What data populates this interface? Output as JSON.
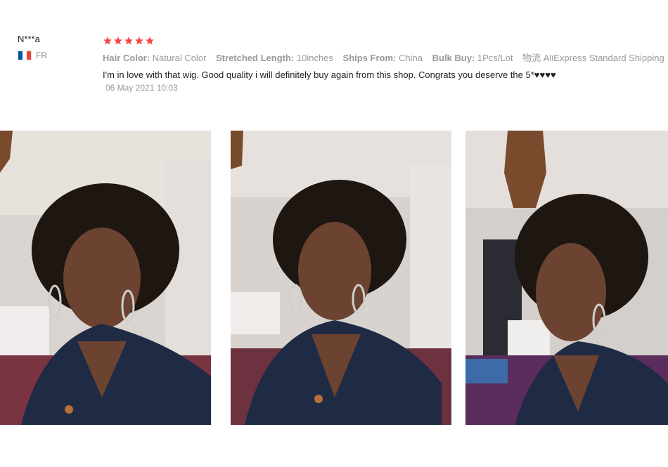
{
  "reviewer": {
    "name": "N***a",
    "country_code": "FR",
    "flag_colors": [
      "#0055a4",
      "#ffffff",
      "#ef4135"
    ]
  },
  "review": {
    "rating": 5,
    "star_color": "#f54646",
    "attributes": [
      {
        "key": "Hair Color:",
        "value": "Natural Color"
      },
      {
        "key": "Stretched Length:",
        "value": "10inches"
      },
      {
        "key": "Ships From:",
        "value": "China"
      },
      {
        "key": "Bulk Buy:",
        "value": "1Pcs/Lot"
      },
      {
        "key": "物流",
        "value": "AliExpress Standard Shipping"
      }
    ],
    "text": "I'm in love with that wig. Good quality i will definitely buy again from this shop. Congrats you deserve the 5*♥♥♥♥",
    "date": "06 May 2021 10:03"
  },
  "photos": [
    {
      "icon": "review-photo"
    },
    {
      "icon": "review-photo"
    },
    {
      "icon": "review-photo"
    }
  ]
}
